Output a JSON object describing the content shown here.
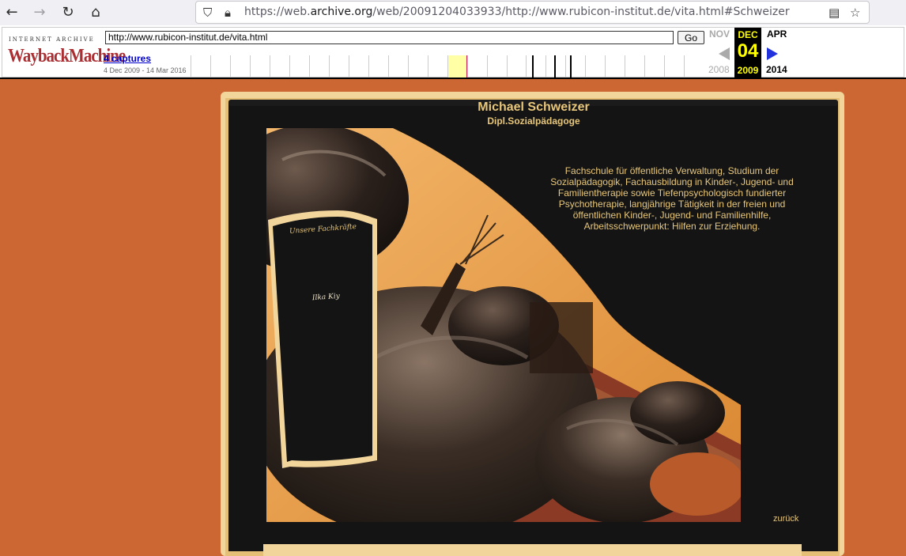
{
  "browser": {
    "url_prefix": "https://web.",
    "url_domain": "archive.org",
    "url_rest": "/web/20091204033933/http://www.rubicon-institut.de/vita.html#Schweizer"
  },
  "wayback": {
    "logo_top": "INTERNET ARCHIVE",
    "logo_main": "WaybackMachine",
    "url_value": "http://www.rubicon-institut.de/vita.html",
    "go_label": "Go",
    "captures_label": "4 captures",
    "range_label": "4 Dec 2009 - 14 Mar 2016",
    "prev_month": "NOV",
    "cur_month": "DEC",
    "next_month": "APR",
    "cur_day": "04",
    "prev_year": "2008",
    "cur_year": "2009",
    "next_year": "2014"
  },
  "page": {
    "name": "Michael Schweizer",
    "title": "Dipl.Sozialpädagoge",
    "bio": "Fachschule für öffentliche Verwaltung, Studium der Sozialpädagogik, Fachausbildung in Kinder-, Jugend- und Familientherapie sowie Tiefenpsychologisch fundierter Psychotherapie, langjährige Tätigkeit in der freien und öffentlichen Kinder-, Jugend- und Familienhilfe, Arbeitsschwerpunkt: Hilfen zur Erziehung.",
    "back_label": "zurück",
    "script_heading": "Unsere Fachkräfte",
    "script_name": "Ilka Kiy"
  },
  "colors": {
    "page_bg": "#cc6633",
    "text_accent": "#e8c77a",
    "calendar_bg": "#000000",
    "calendar_text": "#ffff00"
  }
}
